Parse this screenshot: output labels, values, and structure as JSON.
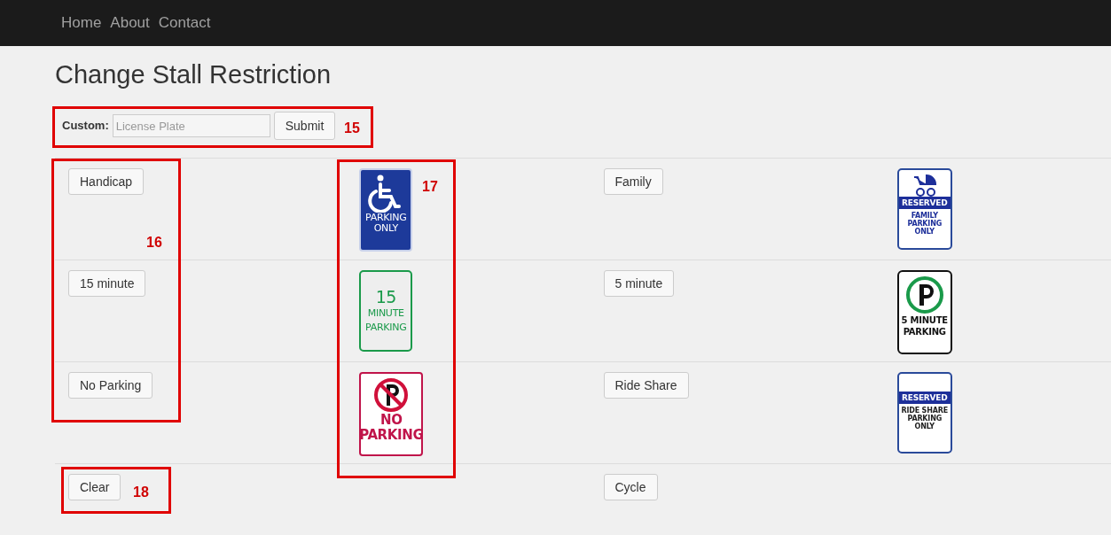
{
  "nav": {
    "links": [
      "Home",
      "About",
      "Contact"
    ]
  },
  "title": "Change Stall Restriction",
  "custom": {
    "label": "Custom:",
    "placeholder": "License Plate",
    "button": "Submit"
  },
  "rows": [
    {
      "left_button": "Handicap",
      "left_sign": {
        "kind": "handicap",
        "lines": [
          "PARKING",
          "ONLY"
        ]
      },
      "right_button": "Family",
      "right_sign": {
        "kind": "family",
        "banner": "RESERVED",
        "lines": [
          "FAMILY",
          "PARKING",
          "ONLY"
        ]
      }
    },
    {
      "left_button": "15 minute",
      "left_sign": {
        "kind": "fifteen",
        "lines": [
          "15",
          "MINUTE",
          "PARKING"
        ]
      },
      "right_button": "5 minute",
      "right_sign": {
        "kind": "five_minute",
        "lines": [
          "5 MINUTE",
          "PARKING"
        ]
      }
    },
    {
      "left_button": "No Parking",
      "left_sign": {
        "kind": "no_parking",
        "lines": [
          "NO",
          "PARKING"
        ]
      },
      "right_button": "Ride Share",
      "right_sign": {
        "kind": "ride_share",
        "banner": "RESERVED",
        "lines": [
          "RIDE SHARE",
          "PARKING",
          "ONLY"
        ]
      }
    },
    {
      "left_button": "Clear",
      "right_button": "Cycle"
    }
  ],
  "annotations": [
    {
      "kind": "custom",
      "label": "15"
    },
    {
      "kind": "buttons",
      "label": "16"
    },
    {
      "kind": "signs",
      "label": "17"
    },
    {
      "kind": "clear",
      "label": "18"
    }
  ]
}
